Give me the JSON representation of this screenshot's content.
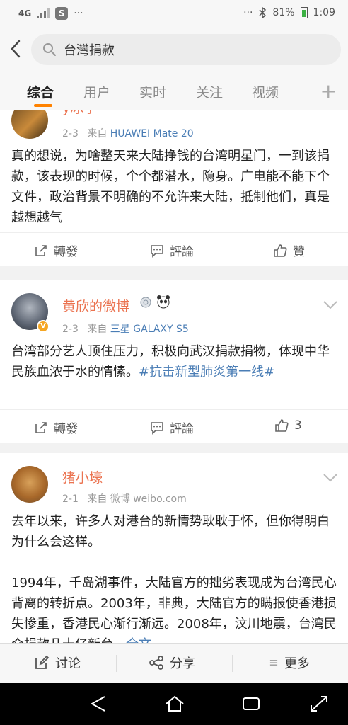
{
  "status": {
    "network": "4G",
    "signal_strength_level": 3,
    "app_icon": "S",
    "dots_left": "···",
    "dots_right": "···",
    "battery": "81%",
    "time": "1:09"
  },
  "search": {
    "query": "台灣捐款"
  },
  "tabs": [
    {
      "label": "综合",
      "active": true
    },
    {
      "label": "用户"
    },
    {
      "label": "实时"
    },
    {
      "label": "关注"
    },
    {
      "label": "视频"
    }
  ],
  "tab_add": "+",
  "posts": [
    {
      "username": "y冰宇",
      "date": "2-3",
      "via": "来自",
      "source": "HUAWEI Mate 20",
      "text": "真的想说，为啥整天来大陆挣钱的台湾明星门，一到该捐款，该表现的时候，个个都潜水，隐身。广电能不能下个文件，政治背景不明确的不允许来大陆，抵制他们，真是越想越气",
      "repost": "轉發",
      "comment": "評論",
      "like": "贊"
    },
    {
      "username": "黄欣的微博",
      "date": "2-3",
      "via": "来自",
      "source": "三星 GALAXY S5",
      "text": "台湾部分艺人顶住压力，积极向武汉捐款捐物，体现中华民族血浓于水的情愫。",
      "tag": "#抗击新型肺炎第一线#",
      "repost": "轉發",
      "comment": "評論",
      "like": "3"
    },
    {
      "username": "猪小壕",
      "date": "2-1",
      "via": "来自",
      "source": "微博 weibo.com",
      "text_p1": "去年以来，许多人对港台的新情势耿耿于怀，但你得明白为什么会这样。",
      "text_p2": "1994年，千岛湖事件，大陆官方的拙劣表现成为台湾民心背离的转折点。2003年，非典，大陆官方的瞒报使香港损失惨重，香港民心渐行渐远。2008年，汶川地震，台湾民众捐款几十亿新台",
      "more": "…全文"
    }
  ],
  "bottom_bar": {
    "discuss": "讨论",
    "share": "分享",
    "more": "更多"
  }
}
